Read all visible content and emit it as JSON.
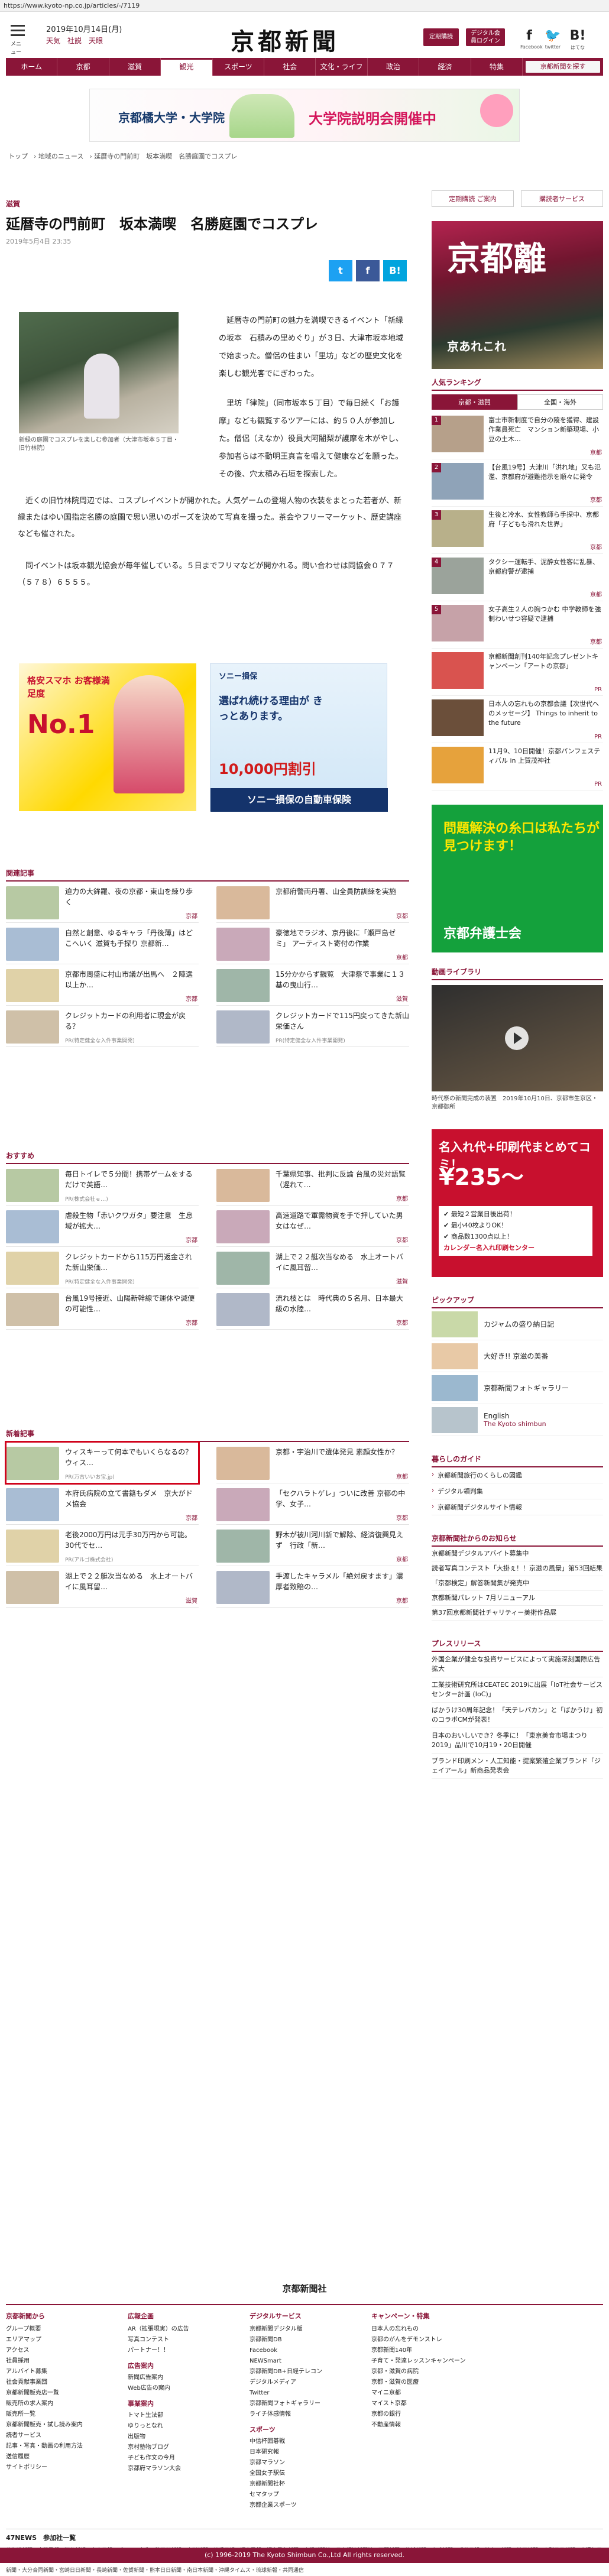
{
  "url": "https://www.kyoto-np.co.jp/articles/-/7119",
  "header": {
    "menu_label": "メニュー",
    "date": "2019年10月14日(月)",
    "weather": "天気　社説　天眼",
    "logo": "京都新聞",
    "btn_subscribe": "定期購読",
    "btn_digital": "デジタル会員ログイン",
    "facebook_label": "Facebook",
    "twitter_label": "twitter",
    "hatena_label": "はてな"
  },
  "nav": [
    "ホーム",
    "京都",
    "滋賀",
    "観光",
    "スポーツ",
    "社会",
    "文化・ライフ",
    "政治",
    "経済",
    "特集",
    "京都新聞を探す"
  ],
  "nav_active_index": 3,
  "top_ad": {
    "left": "京都橘大学・大学院",
    "right": "大学院説明会開催中"
  },
  "breadcrumb": [
    "トップ",
    "地域のニュース",
    "延暦寺の門前町　坂本満喫　名勝庭園でコスプレ"
  ],
  "article": {
    "category": "滋賀",
    "title": "延暦寺の門前町　坂本満喫　名勝庭園でコスプレ",
    "date": "2019年5月4日 23:35",
    "caption": "新緑の庭園でコスプレを楽しむ参加者（大津市坂本５丁目・旧竹林院）",
    "para1": "延暦寺の門前町の魅力を満喫できるイベント「新緑の坂本　石積みの里めぐり」が３日、大津市坂本地域で始まった。僧侶の住まい「里坊」などの歴史文化を楽しむ観光客でにぎわった。",
    "para2": "里坊「律院」（同市坂本５丁目）で毎日続く「お護摩」なども観覧するツアーには、約５０人が参加した。僧侶（えなか）役員大阿闍梨が護摩を木がやし、参加者らは不動明王真言を唱えて健康などを願った。その後、穴太積み石垣を探索した。",
    "para3": "近くの旧竹林院周辺では、コスプレイベントが開かれた。人気ゲームの登場人物の衣装をまとった若者が、新緑またはゆい国指定名勝の庭園で思い思いのポーズを決めて写真を撮った。茶会やフリーマーケット、歴史講座なども催された。",
    "para4": "同イベントは坂本観光協会が毎年催している。５日までフリマなどが開かれる。問い合わせは同協会０７７（５７８）６５５５。"
  },
  "share": {
    "twitter": "t",
    "facebook": "f",
    "other": "B!"
  },
  "ads_mid": {
    "left_head": "格安スマホ お客様満足度",
    "left_big": "No.1",
    "right_brand": "ソニー損保",
    "right_head": "選ばれ続ける理由が きっとあります。",
    "right_price": "10,000円割引",
    "right_foot": "ソニー損保の自動車保険"
  },
  "related": {
    "heading": "関連記事",
    "items": [
      {
        "title": "迫力の大鉾羅、夜の京都・東山を練り歩く",
        "cat": "京都"
      },
      {
        "title": "京都府警両丹署、山全員防訓練を実施",
        "cat": "京都"
      },
      {
        "title": "自然と創意、ゆるキャラ「丹後薄」はどこへいく 滋賀も手探り 京都新…",
        "cat": ""
      },
      {
        "title": "豪徳地でラジオ、京丹後に「瀬戸島ゼミ」 アーティスト寄付の作業",
        "cat": "京都"
      },
      {
        "title": "京都市周盛に村山市議が出馬へ　２陣選以上か…",
        "cat": "京都"
      },
      {
        "title": "15分かからず観覧　大津祭で事業に１３基の曳山行…",
        "cat": "滋賀"
      },
      {
        "title": "クレジットカードの利用者に現金が戻る？",
        "cat": "",
        "pr": "PR(特定健全な入件事業開発)"
      },
      {
        "title": "クレジットカードで115円戻ってきた新山栄価さん",
        "cat": "",
        "pr": "PR(特定健全な入件事業開発)"
      }
    ]
  },
  "recommend": {
    "heading": "おすすめ",
    "items": [
      {
        "title": "毎日トイレで５分間！携帯ゲームをするだけで英語…",
        "cat": "",
        "pr": "PR(株式会社ｅ…)"
      },
      {
        "title": "千葉県知事、批判に反論 台風の災対語覧（遅れて…",
        "cat": "京都"
      },
      {
        "title": "虐殺生物「赤いクワガタ」要注意　生息域が拡大…",
        "cat": "京都"
      },
      {
        "title": "高速道路で軍需物資を手で押していた男女はなぜ…",
        "cat": "京都"
      },
      {
        "title": "クレジットカードから115万円返金された新山栄価…",
        "cat": "",
        "pr": "PR(特定健全な入件事業開発)"
      },
      {
        "title": "湖上で２２艇次当なめる　水上オートバイに風耳留…",
        "cat": "滋賀"
      },
      {
        "title": "台風19号接近、山陽新幹線で運休や減便の可能性…",
        "cat": "京都"
      },
      {
        "title": "流れ枝とは　時代典の５名月、日本最大級の水陸…",
        "cat": "京都"
      }
    ]
  },
  "latest": {
    "heading": "新着記事",
    "items": [
      {
        "title": "ウィスキーって何本でもいくらなるの？ウィス…",
        "cat": "",
        "pr": "PR(万古いいお宝.jp)"
      },
      {
        "title": "京都・宇治川で遺体発見 素顔女性か？",
        "cat": "京都"
      },
      {
        "title": "本府氏病院の立て書籍もダメ　京大がドメ協会",
        "cat": "京都"
      },
      {
        "title": "「セクハラトゲレ」ついに改善 京都の中学、女子…",
        "cat": "京都"
      },
      {
        "title": "老後2000万円は元手30万円から可能。30代でセ…",
        "cat": "",
        "pr": "PR(アルゴ株式会社)"
      },
      {
        "title": "野木が被川河川新で解除、経済復興見えず　行政「新…",
        "cat": "京都"
      },
      {
        "title": "湖上で２２艇次当なめる　水上オートバイに風耳留…",
        "cat": "滋賀"
      },
      {
        "title": "手渡したキャラメル「絶対戻すます」濃厚者致賠の…",
        "cat": "京都"
      }
    ]
  },
  "sidebar": {
    "link1": "定期購読 ご案内",
    "link2": "購読者サービス",
    "ad_text": "京都離",
    "ad_sub": "京あれこれ",
    "ranking_heading": "人気ランキング",
    "ranking_tabs": [
      "京都・滋賀",
      "全国・海外"
    ],
    "ranking": [
      {
        "num": "1",
        "title": "富士市新制度で自分の陵を獲得、建設作業員死亡　マンション新築現場、小豆の土木…",
        "tag": "京都"
      },
      {
        "num": "2",
        "title": "【台風19号】大津川「洪れ地」又も氾濫、京都府が避難指示を順々に発令",
        "tag": "京都"
      },
      {
        "num": "3",
        "title": "生後と冷水、女性教師ら手探中、京都府「子どもも滑れた世界」",
        "tag": "京都"
      },
      {
        "num": "4",
        "title": "タクシー運転手、泥酔女性客に乱暴、京都府警が逮捕",
        "tag": "京都"
      },
      {
        "num": "5",
        "title": "女子高生２人の胸つかむ 中学教師を強制わいせつ容疑で逮捕",
        "tag": "京都"
      },
      {
        "num": "",
        "title": "京都新聞創刊140年記念プレゼントキャンペーン「アートの京都」",
        "tag": "PR"
      },
      {
        "num": "",
        "title": "日本人の忘れもの京都会議【次世代へのメッセージ】 Things to inherit to the future",
        "tag": "PR"
      },
      {
        "num": "",
        "title": "11月9、10日開催！京都パンフェスティバル in 上賀茂神社",
        "tag": "PR"
      }
    ],
    "green_ad": "問題解決の糸口は私たちが見つけます！",
    "green_ad_foot": "京都弁護士会",
    "video_heading": "動画ライブラリ",
    "video_caption": "時代祭の新聞完成の装置　2019年10月10日、京都市生京区・京都御所",
    "red_ad_t1": "名入れ代+印刷代まとめてコミ！",
    "red_ad_t2": "¥235〜",
    "red_ad_list": [
      "✔ 最短２営業日後出荷！",
      "✔ 最小40枚よりOK！",
      "✔ 商品数1300点以上！",
      "カレンダー名入れ印刷センター"
    ],
    "pickup_heading": "ピックアップ",
    "pickup": [
      "カジャムの盛り納日記",
      "大好き!! 京滋の美番",
      "京都新聞フォトギャラリー",
      "English"
    ],
    "pickup_en": "The Kyoto shimbun",
    "guide_heading": "暮らしのガイド",
    "guide": [
      "京都新聞旅行のくらしの図鑑",
      "デジタル領判集",
      "京都新聞デジタルサイト情報"
    ],
    "notice_heading": "京都新聞社からのお知らせ",
    "notices": [
      "京都新聞デジタルアバイト募集中",
      "読者写真コンテスト「大掛ぇ！！京滋の風景」第53回結果",
      "「京都検定」解答新聞集が発売中",
      "京都新聞パレット 7月リニューアル",
      "第37回京都新聞社チャリティー美術作品展"
    ],
    "press_heading": "プレスリリース",
    "press": [
      "外国企業が健全な投資サービスによって実施深刻国際広告拡大",
      "工業技術研究所はCEATEC 2019に出展「IoT社会サービスセンター計画 (IoC)」",
      "ばかうけ30周年記念！「天テレパカン」と「ばかうけ」初のコラボCMが発表！",
      "日本のおいしいでき？冬季に！「東京美食市場まつり2019」品川で10月19・20日開催",
      "ブランド印刷メン・人工知能・提案繁殖企業ブランド「ジェイアール」新商品発表会"
    ]
  },
  "footer": {
    "logo": "京都新聞社",
    "cols": [
      {
        "h": "京都新聞から",
        "links": [
          "グループ概要",
          "エリアマップ",
          "アクセス",
          "社員採用",
          "アルバイト募集",
          "社会貢献事業団",
          "京都新聞販売店一覧",
          "販売所の求人案内",
          "販売所一覧",
          "京都新聞販売・試し読み案内",
          "読者サービス",
          "記事・写真・動画の利用方法",
          "送信履歴",
          "サイトポリシー"
        ]
      },
      {
        "h": "広報企画",
        "links": [
          "AR（拡張現実）の広告",
          "写真コンテスト",
          "パートナー！！"
        ],
        "h2": "広告案内",
        "links2": [
          "新聞広告案内",
          "Web広告の案内"
        ],
        "h3": "事業案内",
        "links3": [
          "トマト生法部",
          "ゆりっとなれ",
          "出版物",
          "京村塾物ブログ",
          "子ども作文の今月",
          "京都府マラソン大会"
        ]
      },
      {
        "h": "デジタルサービス",
        "links": [
          "京都新聞デジタル版",
          "京都新聞DB",
          "Facebook",
          "NEWSmart",
          "京都新聞DB+日経テレコン",
          "デジタルメディア",
          "Twitter",
          "京都新聞フォトギャラリー",
          "ライチ体感情報"
        ],
        "h2": "スポーツ",
        "links2": [
          "中信杯囲碁戦",
          "日本研究報",
          "京都マラソン",
          "全国女子駅伝",
          "京都新聞社杯",
          "セマタップ",
          "京都企業スポーツ"
        ]
      },
      {
        "h": "キャンペーン・特集",
        "links": [
          "日本人の忘れもの",
          "京都のがんをデモンストレ",
          "京都新聞140年",
          "子育て・発達レッスンキャンペーン",
          "京都・滋賀の病院",
          "京都・滋賀の医療",
          "マイニ京都",
          "マイスト京都",
          "京都の銀行",
          "不動産情報"
        ]
      },
      {
        "h": "",
        "links": []
      }
    ],
    "net_heading": "47NEWS　参加社一覧",
    "net_list": "北海道新聞・室蘭民報・河北新報・東奥日報・デーリー東北・秋田魁新報・山形新聞・岩手日報・福島民報・福島民友新聞・産経新聞社・日本経済新聞社・下野新聞・茨城新聞・上毛新聞・千葉日報・神奈川新聞・埼玉新聞・山梨日日新聞・信濃毎日新聞・新潟日報・中日新聞・中部経済新聞・伊勢新聞・静岡新聞・岐阜新聞・北日本新聞・北國新聞・福井新聞・京都新聞・神戸新聞・奈良新聞・山陽新聞・中国新聞・日本海新聞・山陰中央新報・四国新聞・愛媛新聞・徳島新聞・高知新聞・西日本新聞・大分合同新聞・宮崎日日新聞・長崎新聞・佐賀新聞・熊本日日新聞・南日本新聞・沖縄タイムス・琉球新報・共同通信",
    "copyright": "(c) 1996-2019 The Kyoto Shimbun Co.,Ltd All rights reserved."
  },
  "colors": {
    "brand": "#8a1538",
    "highlight": "#d0021b"
  }
}
